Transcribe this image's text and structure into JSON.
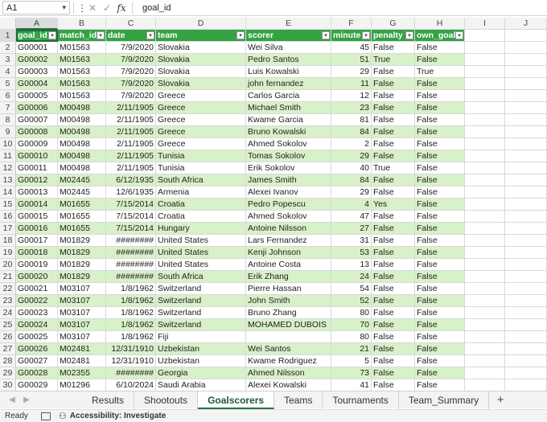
{
  "formula_bar": {
    "name_box": "A1",
    "fx_label": "fx",
    "value": "goal_id"
  },
  "columns": [
    "A",
    "B",
    "C",
    "D",
    "E",
    "F",
    "G",
    "H",
    "I",
    "J"
  ],
  "header": [
    "goal_id",
    "match_id",
    "date",
    "team",
    "scorer",
    "minute",
    "penalty",
    "own_goal"
  ],
  "rows": [
    [
      "G00001",
      "M01563",
      "7/9/2020",
      "Slovakia",
      "Wei Silva",
      "45",
      "False",
      "False"
    ],
    [
      "G00002",
      "M01563",
      "7/9/2020",
      "Slovakia",
      "Pedro Santos",
      "51",
      "True",
      "False"
    ],
    [
      "G00003",
      "M01563",
      "7/9/2020",
      "Slovakia",
      "Luis Kowalski",
      "29",
      "False",
      "True"
    ],
    [
      "G00004",
      "M01563",
      "7/9/2020",
      "Slovakia",
      "john fernandez",
      "11",
      "False",
      "False"
    ],
    [
      "G00005",
      "M01563",
      "7/9/2020",
      "Greece",
      "Carlos Garcia",
      "12",
      "False",
      "False"
    ],
    [
      "G00006",
      "M00498",
      "2/11/1905",
      "Greece",
      "Michael Smith",
      "23",
      "False",
      "False"
    ],
    [
      "G00007",
      "M00498",
      "2/11/1905",
      "Greece",
      "Kwame Garcia",
      "81",
      "False",
      "False"
    ],
    [
      "G00008",
      "M00498",
      "2/11/1905",
      "Greece",
      "Bruno Kowalski",
      "84",
      "False",
      "False"
    ],
    [
      "G00009",
      "M00498",
      "2/11/1905",
      "Greece",
      "Ahmed Sokolov",
      "2",
      "False",
      "False"
    ],
    [
      "G00010",
      "M00498",
      "2/11/1905",
      "Tunisia",
      "Tomas Sokolov",
      "29",
      "False",
      "False"
    ],
    [
      "G00011",
      "M00498",
      "2/11/1905",
      "Tunisia",
      "Erik Sokolov",
      "40",
      "True",
      "False"
    ],
    [
      "G00012",
      "M02445",
      "6/12/1935",
      "South Africa",
      " James Smith",
      "84",
      "False",
      "False"
    ],
    [
      "G00013",
      "M02445",
      "12/6/1935",
      "Armenia",
      "Alexei Ivanov",
      "29",
      "False",
      "False"
    ],
    [
      "G00014",
      "M01655",
      "7/15/2014",
      "Croatia",
      "Pedro Popescu",
      "4",
      "Yes",
      "False"
    ],
    [
      "G00015",
      "M01655",
      "7/15/2014",
      "Croatia",
      "Ahmed Sokolov",
      "47",
      "False",
      "False"
    ],
    [
      "G00016",
      "M01655",
      "7/15/2014",
      "Hungary",
      "Antoine Nilsson",
      "27",
      "False",
      "False"
    ],
    [
      "G00017",
      "M01829",
      "########",
      "United States",
      "Lars Fernandez",
      "31",
      "False",
      "False"
    ],
    [
      "G00018",
      "M01829",
      "########",
      "United States",
      "Kenji Johnson",
      "53",
      "False",
      "False"
    ],
    [
      "G00019",
      "M01829",
      "########",
      "United States",
      "Antoine Costa",
      "13",
      "False",
      "False"
    ],
    [
      "G00020",
      "M01829",
      "########",
      "South Africa",
      "Erik Zhang",
      "24",
      "False",
      "False"
    ],
    [
      "G00021",
      "M03107",
      "1/8/1962",
      "Switzerland",
      "Pierre Hassan",
      "54",
      "False",
      "False"
    ],
    [
      "G00022",
      "M03107",
      "1/8/1962",
      "Switzerland",
      "John Smith",
      "52",
      "False",
      "False"
    ],
    [
      "G00023",
      "M03107",
      "1/8/1962",
      "Switzerland",
      "Bruno Zhang",
      "80",
      "False",
      "False"
    ],
    [
      "G00024",
      "M03107",
      "1/8/1962",
      "Switzerland",
      "MOHAMED DUBOIS",
      "70",
      "False",
      "False"
    ],
    [
      "G00025",
      "M03107",
      "1/8/1962",
      "Fiji",
      "",
      "80",
      "False",
      "False"
    ],
    [
      "G00026",
      "M02481",
      "12/31/1910",
      "Uzbekistan",
      "Wei Santos",
      "21",
      "False",
      "False"
    ],
    [
      "G00027",
      "M02481",
      "12/31/1910",
      "Uzbekistan",
      "Kwame Rodriguez",
      "5",
      "False",
      "False"
    ],
    [
      "G00028",
      "M02355",
      "########",
      "Georgia",
      "Ahmed Nilsson",
      "73",
      "False",
      "False"
    ],
    [
      "G00029",
      "M01296",
      "6/10/2024",
      "Saudi Arabia",
      "Alexei Kowalski",
      "41",
      "False",
      "False"
    ]
  ],
  "tabs": [
    "Results",
    "Shootouts",
    "Goalscorers",
    "Teams",
    "Tournaments",
    "Team_Summary"
  ],
  "active_tab": "Goalscorers",
  "add_tab_label": "+",
  "status": {
    "ready": "Ready",
    "accessibility": "Accessibility: Investigate"
  },
  "colors": {
    "header_green": "#33a344",
    "band_green": "#d8f1c8",
    "accent": "#217346"
  }
}
